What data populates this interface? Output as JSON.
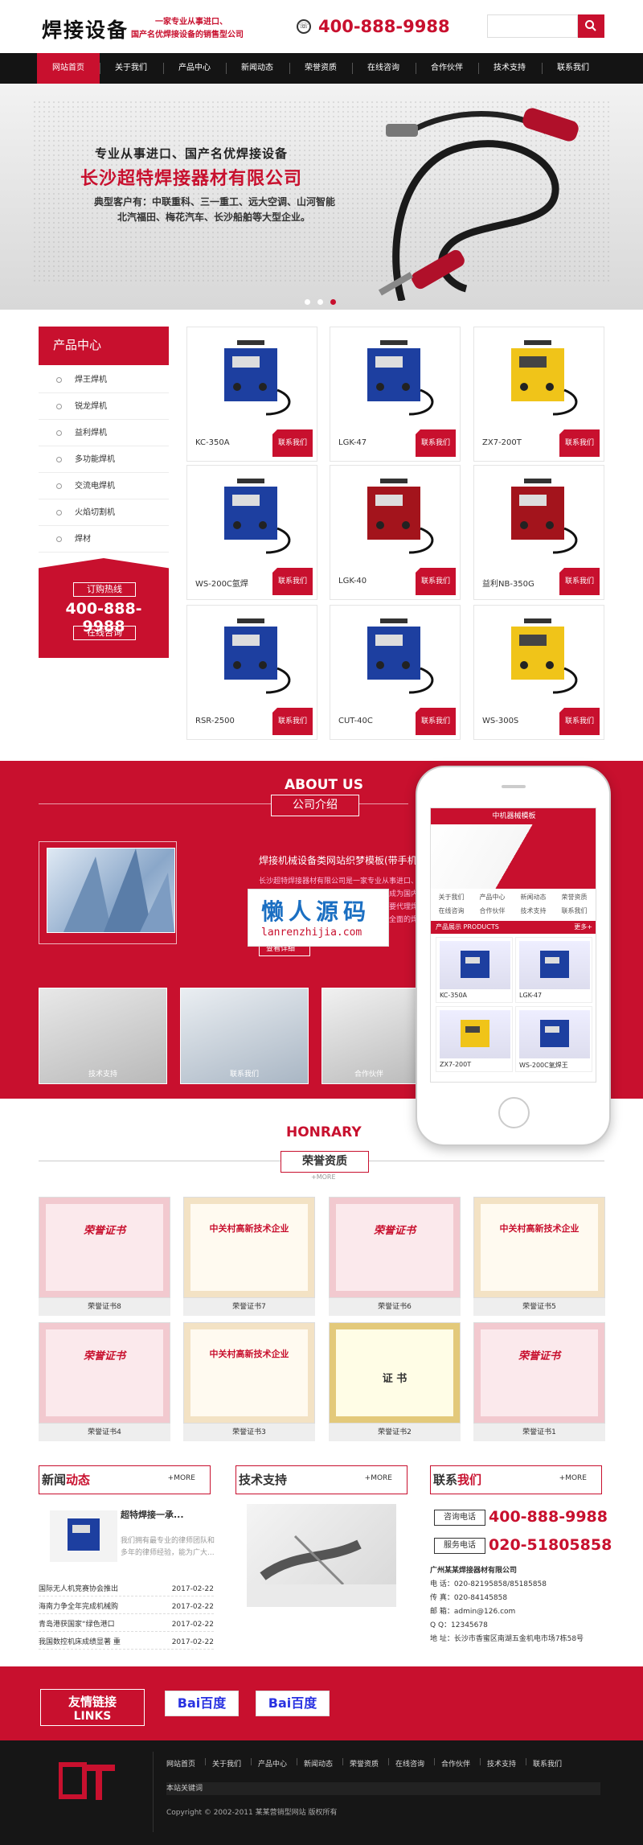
{
  "header": {
    "logo": "焊接设备",
    "slogan_1": "一家专业从事进口、",
    "slogan_2": "国产名优焊接设备的销售型公司",
    "phone": "400-888-9988",
    "search_placeholder": ""
  },
  "nav": [
    "网站首页",
    "关于我们",
    "产品中心",
    "新闻动态",
    "荣誉资质",
    "在线咨询",
    "合作伙伴",
    "技术支持",
    "联系我们"
  ],
  "banner": {
    "line1": "专业从事进口、国产名优焊接设备",
    "line2": "长沙超特焊接器材有限公司",
    "line3": "典型客户有：中联重科、三一重工、远大空调、山河智能",
    "line4": "北汽福田、梅花汽车、长沙船舶等大型企业。"
  },
  "sidebar": {
    "title": "产品中心",
    "items": [
      "焊王焊机",
      "锐龙焊机",
      "益利焊机",
      "多功能焊机",
      "交流电焊机",
      "火焰切割机",
      "焊材"
    ],
    "hotline_label": "订购热线",
    "hotline": "400-888-9988",
    "consult": "在线咨询"
  },
  "products": {
    "button": "联系我们",
    "items": [
      {
        "name": "KC-350A",
        "color": "blue"
      },
      {
        "name": "LGK-47",
        "color": "blue"
      },
      {
        "name": "ZX7-200T",
        "color": "yellow"
      },
      {
        "name": "WS-200C氩焊",
        "color": "blue"
      },
      {
        "name": "LGK-40",
        "color": "red"
      },
      {
        "name": "益利NB-350G",
        "color": "red"
      },
      {
        "name": "RSR-2500",
        "color": "blue"
      },
      {
        "name": "CUT-40C",
        "color": "blue"
      },
      {
        "name": "WS-300S",
        "color": "yellow"
      }
    ]
  },
  "about": {
    "title_en": "ABOUT US",
    "title_cn": "公司介绍",
    "heading": "焊接机械设备类网站织梦模板(带手机端)",
    "text": "长沙超特焊接器材有限公司是一家专业从事进口、国产名优焊接设备的销售型公司，公司已成为国内外著名焊接设备品牌在湖南的代理商，主要代理焊王、锐龙、益利等知名品牌，为客户提供全面的焊接解决方案。",
    "more": "查看详细",
    "photos": [
      "技术支持",
      "联系我们",
      "合作伙伴"
    ]
  },
  "watermark": {
    "cn": "懒人源码",
    "en": "lanrenzhijia.com"
  },
  "phone_mock": {
    "header": "中机器械模板",
    "nav": [
      "关于我们",
      "产品中心",
      "新闻动态",
      "荣誉资质",
      "在线咨询",
      "合作伙伴",
      "技术支持",
      "联系我们"
    ],
    "products_title": "产品展示 PRODUCTS",
    "more": "更多+",
    "products": [
      "KC-350A",
      "LGK-47",
      "ZX7-200T",
      "WS-200C氩焊王"
    ]
  },
  "honor": {
    "title_en": "HONRARY",
    "title_cn": "荣誉资质",
    "more": "+MORE",
    "items": [
      {
        "caption": "荣誉证书8",
        "type": "rongyu"
      },
      {
        "caption": "荣誉证书7",
        "type": "zgc"
      },
      {
        "caption": "荣誉证书6",
        "type": "rongyu"
      },
      {
        "caption": "荣誉证书5",
        "type": "zgc"
      },
      {
        "caption": "荣誉证书4",
        "type": "rongyu"
      },
      {
        "caption": "荣誉证书3",
        "type": "zgc"
      },
      {
        "caption": "荣誉证书2",
        "type": "zhengshu"
      },
      {
        "caption": "荣誉证书1",
        "type": "rongyu"
      }
    ],
    "rongyu_text": "荣誉证书",
    "zgc_text": "中关村高新技术企业",
    "zhengshu_text": "证  书"
  },
  "news": {
    "title_a": "新闻",
    "title_b": "动态",
    "more": "+MORE",
    "feature_title": "超特焊接一承...",
    "feature_text": "我们拥有最专业的律师团队和多年的律师经验，能为广大...",
    "items": [
      {
        "title": "国际无人机竞赛协会推出",
        "date": "2017-02-22"
      },
      {
        "title": "海南力争全年完成机械购",
        "date": "2017-02-22"
      },
      {
        "title": "青岛港获国家“绿色港口",
        "date": "2017-02-22"
      },
      {
        "title": "我国数控机床成绩显著 重",
        "date": "2017-02-22"
      }
    ]
  },
  "tech": {
    "title": "技术支持",
    "more": "+MORE"
  },
  "contact": {
    "title_a": "联系",
    "title_b": "我们",
    "more": "+MORE",
    "label_1": "咨询电话",
    "phone_1": "400-888-9988",
    "label_2": "服务电话",
    "phone_2": "020-51805858",
    "company": "广州某某焊接器材有限公司",
    "lines": [
      "电 话：020-82195858/85185858",
      "传 真：020-84145858",
      "邮 箱：admin@126.com",
      "Q Q：12345678",
      "地 址：长沙市香蜜区南湖五金机电市场7栋58号"
    ]
  },
  "links": {
    "title_cn": "友情链接",
    "title_en": "LINKS",
    "items": [
      "Bai百度",
      "Bai百度"
    ]
  },
  "footer": {
    "nav": [
      "网站首页",
      "关于我们",
      "产品中心",
      "新闻动态",
      "荣誉资质",
      "在线咨询",
      "合作伙伴",
      "技术支持",
      "联系我们"
    ],
    "keywords": "本站关键词",
    "copyright": "Copyright © 2002-2011 某某营销型网站 版权所有"
  },
  "colors": {
    "brand": "#c8102e",
    "dark": "#141414"
  }
}
